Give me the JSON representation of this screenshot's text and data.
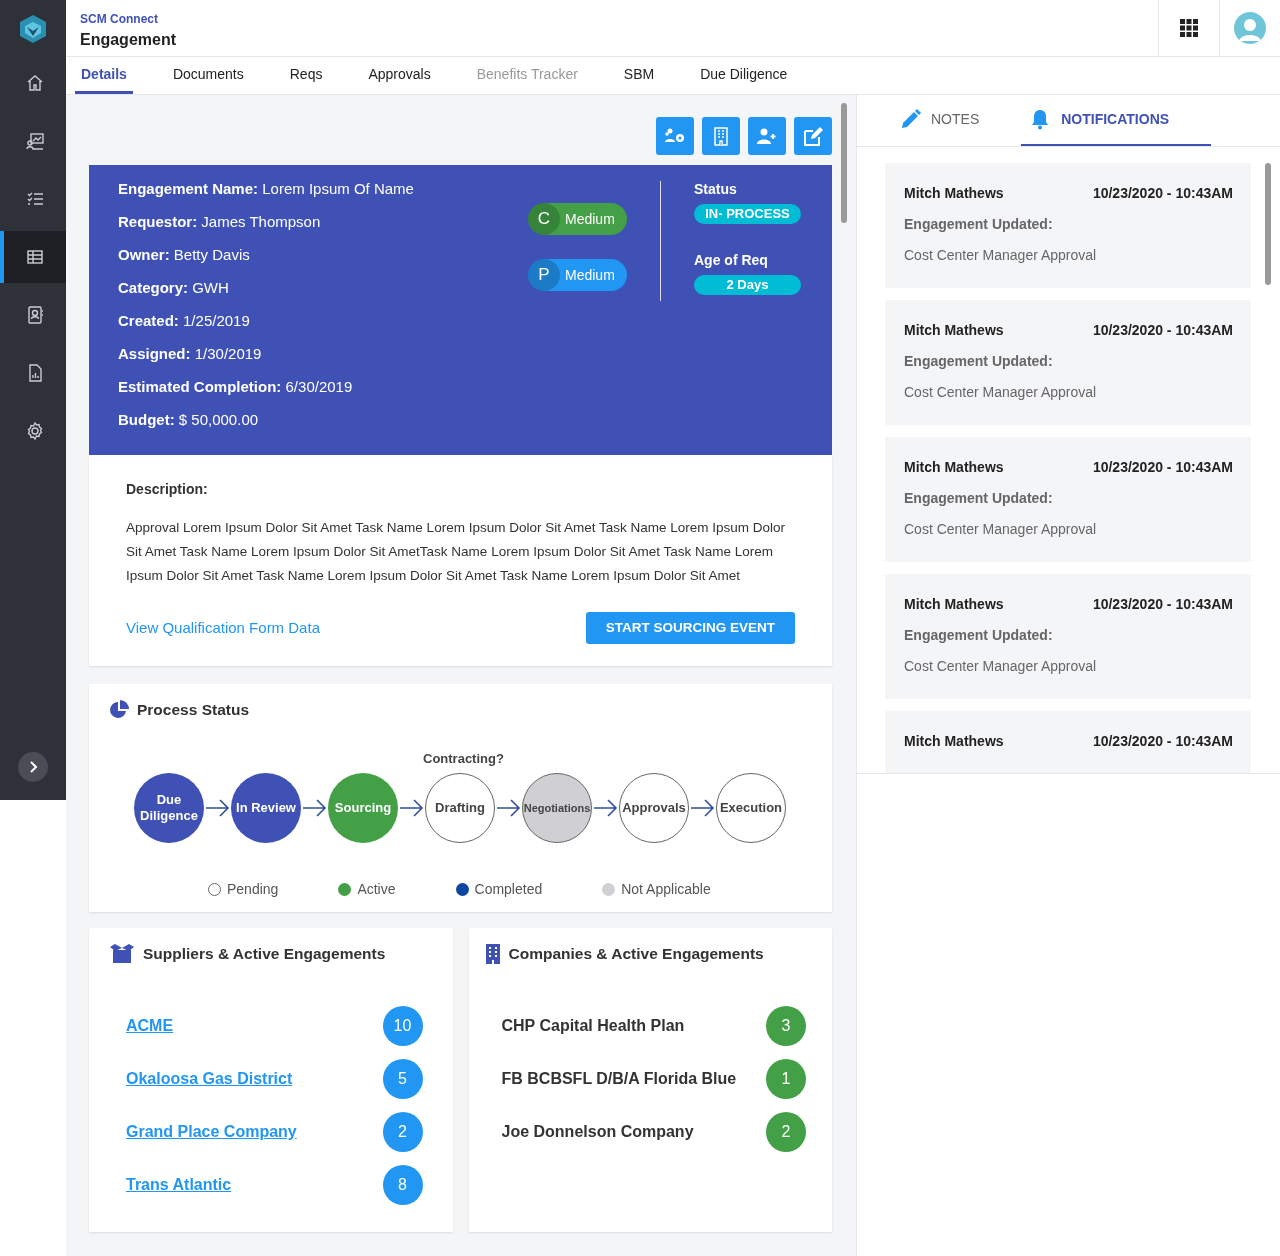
{
  "sidebar": {
    "items": [
      {
        "selected": false
      },
      {
        "selected": false
      },
      {
        "selected": false
      },
      {
        "selected": true
      },
      {
        "selected": false
      },
      {
        "selected": false
      },
      {
        "selected": false
      }
    ]
  },
  "header": {
    "app": "SCM Connect",
    "title": "Engagement"
  },
  "tabs": [
    {
      "label": "Details",
      "selected": true,
      "disabled": false
    },
    {
      "label": "Documents",
      "selected": false,
      "disabled": false
    },
    {
      "label": "Reqs",
      "selected": false,
      "disabled": false
    },
    {
      "label": "Approvals",
      "selected": false,
      "disabled": false
    },
    {
      "label": "Benefits Tracker",
      "selected": false,
      "disabled": true
    },
    {
      "label": "SBM",
      "selected": false,
      "disabled": false
    },
    {
      "label": "Due Diligence",
      "selected": false,
      "disabled": false
    }
  ],
  "summary": {
    "fields": [
      {
        "label": "Engagement Name:",
        "value": "Lorem Ipsum Of Name"
      },
      {
        "label": "Requestor:",
        "value": "James Thompson"
      },
      {
        "label": "Owner:",
        "value": "Betty Davis"
      },
      {
        "label": "Category:",
        "value": "GWH"
      },
      {
        "label": "Created:",
        "value": "1/25/2019"
      },
      {
        "label": "Assigned:",
        "value": "1/30/2019"
      },
      {
        "label": "Estimated Completion:",
        "value": "6/30/2019"
      },
      {
        "label": "Budget:",
        "value": "$ 50,000.00"
      }
    ],
    "chips": [
      {
        "letter": "C",
        "label": "Medium",
        "color": "#43a047"
      },
      {
        "letter": "P",
        "label": "Medium",
        "color": "#2196f3"
      }
    ],
    "status": {
      "label": "Status",
      "value": "IN- PROCESS"
    },
    "age": {
      "label": "Age of Req",
      "value": "2 Days"
    }
  },
  "description": {
    "label": "Description:",
    "text": "Approval Lorem Ipsum Dolor Sit Amet Task Name Lorem Ipsum Dolor Sit Amet Task Name Lorem Ipsum Dolor Sit Amet Task Name Lorem Ipsum Dolor Sit AmetTask Name Lorem Ipsum Dolor Sit Amet Task Name Lorem Ipsum Dolor Sit Amet Task Name Lorem Ipsum Dolor Sit Amet Task Name Lorem Ipsum Dolor Sit Amet",
    "link": "View Qualification Form Data",
    "button": "START SOURCING EVENT"
  },
  "process": {
    "title": "Process Status",
    "group_label": "Contracting?",
    "stages": [
      {
        "label": "Due Diligence",
        "kind": "completed"
      },
      {
        "label": "In Review",
        "kind": "completed"
      },
      {
        "label": "Sourcing",
        "kind": "active"
      },
      {
        "label": "Drafting",
        "kind": "pending"
      },
      {
        "label": "Negotiations",
        "kind": "not_applicable"
      },
      {
        "label": "Approvals",
        "kind": "pending"
      },
      {
        "label": "Execution",
        "kind": "pending"
      }
    ],
    "legend": [
      {
        "label": "Pending",
        "kind": "pending"
      },
      {
        "label": "Active",
        "kind": "active"
      },
      {
        "label": "Completed",
        "kind": "completed"
      },
      {
        "label": "Not Applicable",
        "kind": "not_applicable"
      }
    ]
  },
  "suppliers": {
    "title": "Suppliers & Active Engagements",
    "items": [
      {
        "name": "ACME",
        "count": "10"
      },
      {
        "name": "Okaloosa Gas District",
        "count": "5"
      },
      {
        "name": "Grand Place Company",
        "count": "2"
      },
      {
        "name": "Trans Atlantic",
        "count": "8"
      }
    ]
  },
  "companies": {
    "title": "Companies & Active Engagements",
    "items": [
      {
        "name": "CHP Capital Health Plan",
        "count": "3"
      },
      {
        "name": "FB BCBSFL D/B/A Florida Blue",
        "count": "1"
      },
      {
        "name": "Joe Donnelson Company",
        "count": "2"
      }
    ]
  },
  "panel": {
    "tabs": [
      {
        "label": "NOTES",
        "selected": false
      },
      {
        "label": "NOTIFICATIONS",
        "selected": true
      }
    ],
    "notifications": [
      {
        "author": "Mitch Mathews",
        "time": "10/23/2020 - 10:43AM",
        "title": "Engagement Updated:",
        "detail": "Cost Center Manager Approval"
      },
      {
        "author": "Mitch Mathews",
        "time": "10/23/2020 - 10:43AM",
        "title": "Engagement Updated:",
        "detail": "Cost Center Manager Approval"
      },
      {
        "author": "Mitch Mathews",
        "time": "10/23/2020 - 10:43AM",
        "title": "Engagement Updated:",
        "detail": "Cost Center Manager Approval"
      },
      {
        "author": "Mitch Mathews",
        "time": "10/23/2020 - 10:43AM",
        "title": "Engagement Updated:",
        "detail": "Cost Center Manager Approval"
      },
      {
        "author": "Mitch Mathews",
        "time": "10/23/2020 - 10:43AM"
      }
    ]
  }
}
